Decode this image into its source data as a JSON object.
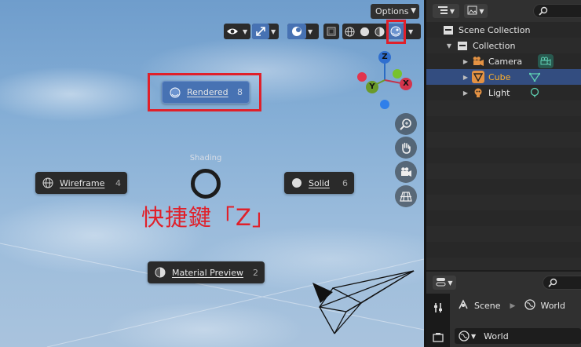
{
  "viewport": {
    "options_label": "Options",
    "pie_menu": {
      "title": "Shading",
      "items": {
        "rendered": {
          "label": "Rendered",
          "key": "8"
        },
        "wireframe": {
          "label": "Wireframe",
          "key": "4"
        },
        "solid": {
          "label": "Solid",
          "key": "6"
        },
        "material_preview": {
          "label": "Material Preview",
          "key": "2"
        }
      }
    },
    "annotation": "快捷鍵「Z」",
    "gizmo": {
      "z": "Z",
      "x": "X",
      "y": "Y"
    },
    "colors": {
      "highlight": "#e0202a",
      "active": "#4772b3"
    }
  },
  "outliner": {
    "rows": [
      {
        "label": "Scene Collection",
        "icon": "scene-collection-icon"
      },
      {
        "label": "Collection",
        "icon": "collection-icon"
      },
      {
        "label": "Camera",
        "icon": "camera-icon"
      },
      {
        "label": "Cube",
        "icon": "cube-icon",
        "selected": true
      },
      {
        "label": "Light",
        "icon": "light-icon"
      }
    ]
  },
  "properties": {
    "breadcrumb": {
      "scene": "Scene",
      "world": "World"
    },
    "world_field": "World"
  }
}
